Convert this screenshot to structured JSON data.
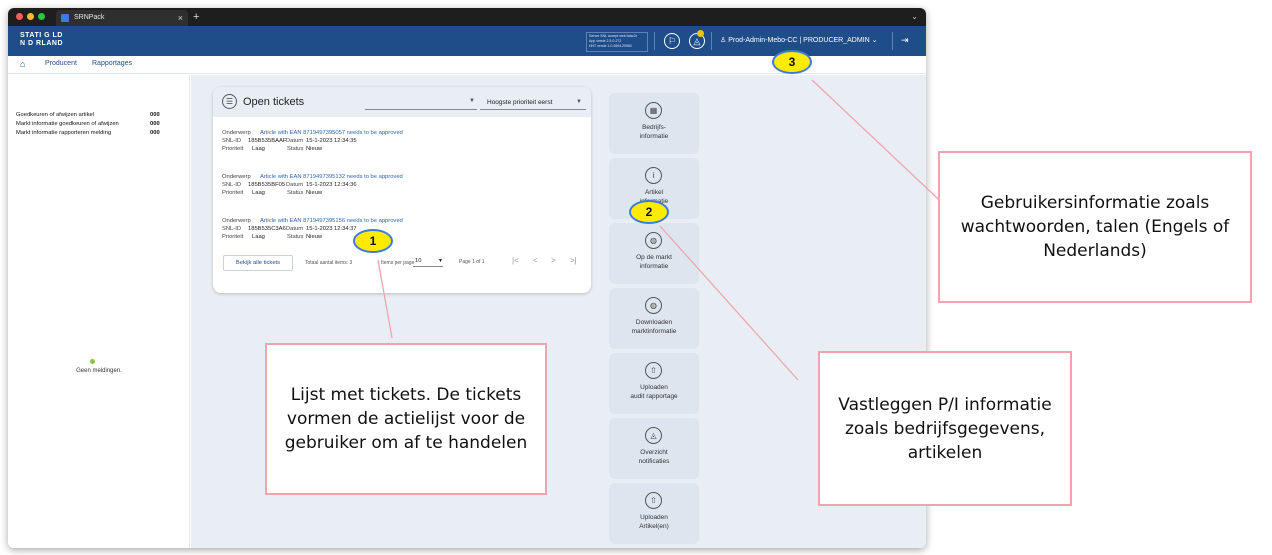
{
  "browser": {
    "tab_title": "SRNPack",
    "tab_close": "×",
    "new_tab": "+",
    "tab_menu": "⌄"
  },
  "header": {
    "logo_line1": "STATI G LD",
    "logo_line2": "N D RLAND",
    "server_info": "Server SNL accept web bdsc2r\nApp versie 2.5.0-272\nHHT versie 1.0.4694.29960",
    "flag_icon": "flag-icon",
    "bell_icon": "bell-icon",
    "user_label": "Prod-Admin-Mebo-CC | PRODUCER_ADMIN ⌄",
    "logout_icon": "logout-icon"
  },
  "breadcrumb": {
    "items": [
      "Producent",
      "Rapportages"
    ]
  },
  "sidebar": {
    "stats": [
      {
        "label": "Goedkeuren of afwijzen artikel",
        "value": "000"
      },
      {
        "label": "Markt informatie goedkeuren of afwijzen",
        "value": "000"
      },
      {
        "label": "Markt informatie rapporteren melding",
        "value": "000"
      }
    ],
    "no_notifications": "Geen meldingen."
  },
  "tickets": {
    "title": "Open tickets",
    "sort_label": "Hoogste prioriteit eerst",
    "field_labels": {
      "subject": "Onderwerp",
      "snl_id": "SNL-ID",
      "date": "Datum",
      "priority": "Prioriteit",
      "status": "Status"
    },
    "items": [
      {
        "subject": "Article with EAN 8719497395057 needs to be approved",
        "snl_id": "185B535BAAF",
        "date": "15-1-2023 12:34:35",
        "priority": "Laag",
        "status": "Nieuw"
      },
      {
        "subject": "Article with EAN 8719497395132 needs to be approved",
        "snl_id": "185B535BF05",
        "date": "15-1-2023 12:34:36",
        "priority": "Laag",
        "status": "Nieuw"
      },
      {
        "subject": "Article with EAN 8719497395156 needs to be approved",
        "snl_id": "185B535C3A6",
        "date": "15-1-2023 12:34:37",
        "priority": "Laag",
        "status": "Nieuw"
      }
    ],
    "view_all": "Bekijk alle tickets",
    "total_items": "Totaal aantal items: 3",
    "per_page_label": "Items per page",
    "per_page_value": "10",
    "page_info": "Page 1 of 1",
    "pager": [
      "|<",
      "<",
      ">",
      ">|"
    ]
  },
  "tiles": [
    {
      "icon": "building-icon",
      "glyph": "▦",
      "label": "Bedrijfs-\ninformatie"
    },
    {
      "icon": "info-icon",
      "glyph": "i",
      "label": "Artikel\ninformatie"
    },
    {
      "icon": "globe-icon",
      "glyph": "◍",
      "label": "Op de markt\ninformatie"
    },
    {
      "icon": "download-globe-icon",
      "glyph": "◍",
      "label": "Downloaden\nmarktinformatie"
    },
    {
      "icon": "upload-icon",
      "glyph": "⇧",
      "label": "Uploaden\naudit rapportage"
    },
    {
      "icon": "bell-icon",
      "glyph": "◬",
      "label": "Overzicht\nnotificaties"
    },
    {
      "icon": "upload-icon",
      "glyph": "⇧",
      "label": "Uploaden\nArtikel(en)"
    }
  ],
  "markers": [
    "1",
    "2",
    "3"
  ],
  "callouts": {
    "c1": "Lijst met tickets. De tickets vormen de actielijst voor de gebruiker om af te handelen",
    "c2": "Vastleggen P/I informatie zoals bedrijfsgegevens, artikelen",
    "c3": "Gebruikersinformatie zoals wachtwoorden, talen (Engels of Nederlands)"
  },
  "colors": {
    "header_bg": "#1f4d8a",
    "main_bg": "#e8eef4",
    "marker_fill": "#ffeb00",
    "marker_border": "#3d7ae0",
    "callout_border": "#f1a4ad"
  }
}
